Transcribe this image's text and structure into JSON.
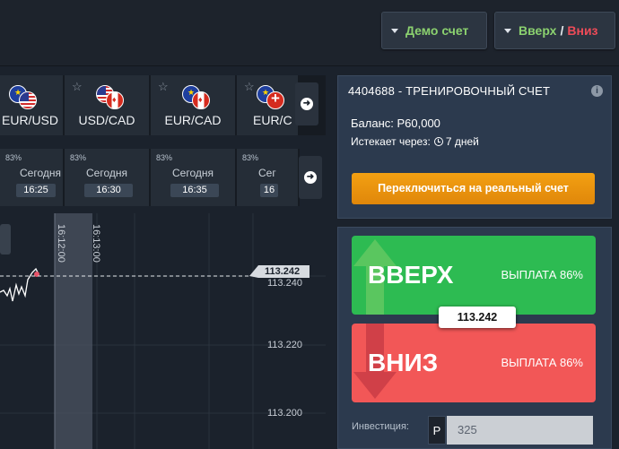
{
  "header": {
    "demo_account_label": "Демо счет",
    "up_label": "Вверх",
    "separator": "/",
    "down_label": "Вниз"
  },
  "pairs": [
    {
      "label": "EUR/USD",
      "flags": [
        "flag-eu",
        "flag-us"
      ],
      "starred": false
    },
    {
      "label": "USD/CAD",
      "flags": [
        "flag-us",
        "flag-ca"
      ],
      "starred": false
    },
    {
      "label": "EUR/CAD",
      "flags": [
        "flag-eu",
        "flag-ca"
      ],
      "starred": false
    },
    {
      "label": "EUR/C",
      "flags": [
        "flag-eu",
        "flag-ch"
      ],
      "starred": false
    }
  ],
  "pairs_star_glyph": "☆",
  "expiries": [
    {
      "percent": "83%",
      "day": "Сегодня",
      "time": "16:25"
    },
    {
      "percent": "83%",
      "day": "Сегодня",
      "time": "16:30"
    },
    {
      "percent": "83%",
      "day": "Сегодня",
      "time": "16:35"
    },
    {
      "percent": "83%",
      "day": "Сег",
      "time": "16"
    }
  ],
  "chart": {
    "price_labels": [
      "113.240",
      "113.220",
      "113.200"
    ],
    "current_price": "113.242",
    "time_marker_1": "16:12:00",
    "time_marker_2": "16:13:00"
  },
  "account": {
    "title": "4404688 - ТРЕНИРОВОЧНЫЙ СЧЕТ",
    "balance": "Баланс: Р60,000",
    "expires_prefix": "Истекает через:",
    "expires_value": "7 дней",
    "switch_button": "Переключиться на реальный счет"
  },
  "trade": {
    "up_label": "ВВЕРХ",
    "up_payout": "ВЫПЛАТА 86%",
    "down_label": "ВНИЗ",
    "down_payout": "ВЫПЛАТА 86%",
    "current_price": "113.242",
    "investment_label": "Инвестиция:",
    "currency_symbol": "Р",
    "investment_value": "325"
  },
  "colors": {
    "up": "#2dbb52",
    "down": "#f25757",
    "switch": "#f3a012",
    "panel": "#2c3a4e"
  }
}
